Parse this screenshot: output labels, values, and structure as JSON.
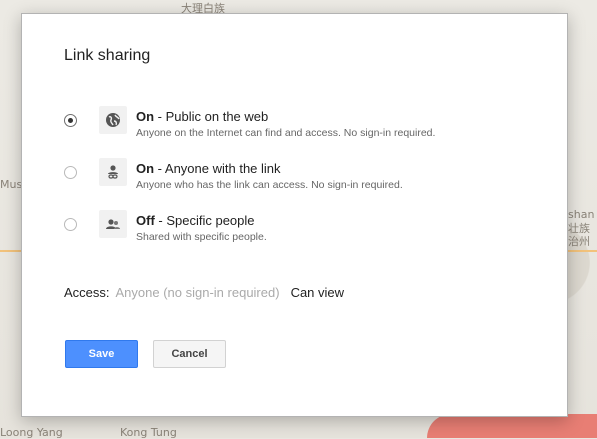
{
  "map": {
    "labels": [
      "大理白族",
      "Muse",
      "shan",
      "壮族",
      "治州",
      "Kong Tung",
      "Loong Yang"
    ]
  },
  "dialog": {
    "title": "Link sharing",
    "options": [
      {
        "state": "On",
        "label": " - Public on the web",
        "description": "Anyone on the Internet can find and access. No sign-in required.",
        "icon": "globe-icon",
        "selected": true
      },
      {
        "state": "On",
        "label": " - Anyone with the link",
        "description": "Anyone who has the link can access. No sign-in required.",
        "icon": "link-person-icon",
        "selected": false
      },
      {
        "state": "Off",
        "label": " - Specific people",
        "description": "Shared with specific people.",
        "icon": "people-icon",
        "selected": false
      }
    ],
    "access": {
      "label": "Access:",
      "value": "Anyone (no sign-in required)",
      "permission": "Can view"
    },
    "buttons": {
      "save": "Save",
      "cancel": "Cancel"
    }
  },
  "colors": {
    "primary": "#4d90fe",
    "dialog_bg": "#ffffff"
  }
}
